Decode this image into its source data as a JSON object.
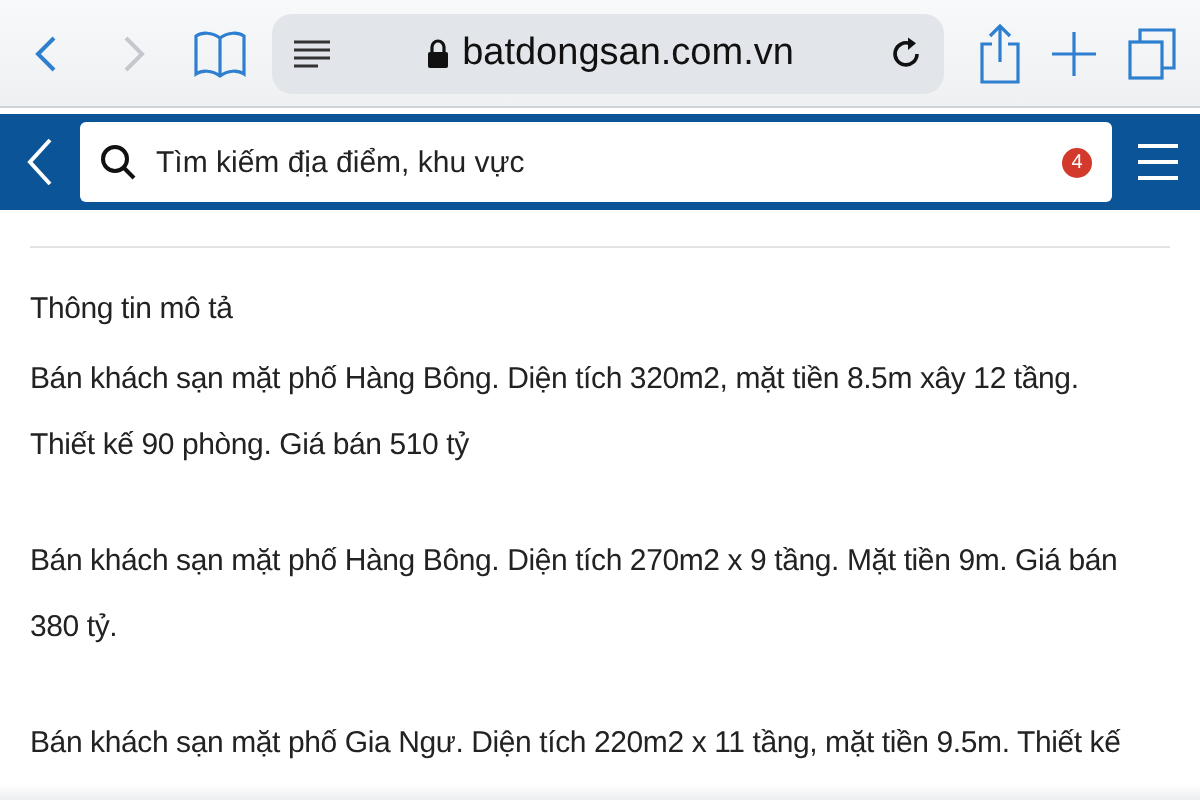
{
  "browser_bar": {
    "url": "batdongsan.com.vn"
  },
  "site_header": {
    "search": {
      "placeholder": "Tìm kiếm địa điểm, khu vực"
    },
    "badge": "4"
  },
  "section": {
    "title": "Thông tin mô tả",
    "paragraphs": [
      "Bán khách sạn mặt phố Hàng Bông. Diện tích 320m2, mặt tiền 8.5m xây 12 tầng. Thiết kế 90 phòng. Giá bán 510 tỷ",
      "Bán khách sạn mặt phố Hàng Bông. Diện tích 270m2 x 9 tầng. Mặt tiền 9m. Giá bán 380 tỷ.",
      "Bán khách sạn mặt phố Gia Ngư. Diện tích 220m2 x 11 tầng, mặt tiền 9.5m. Thiết kế"
    ]
  }
}
